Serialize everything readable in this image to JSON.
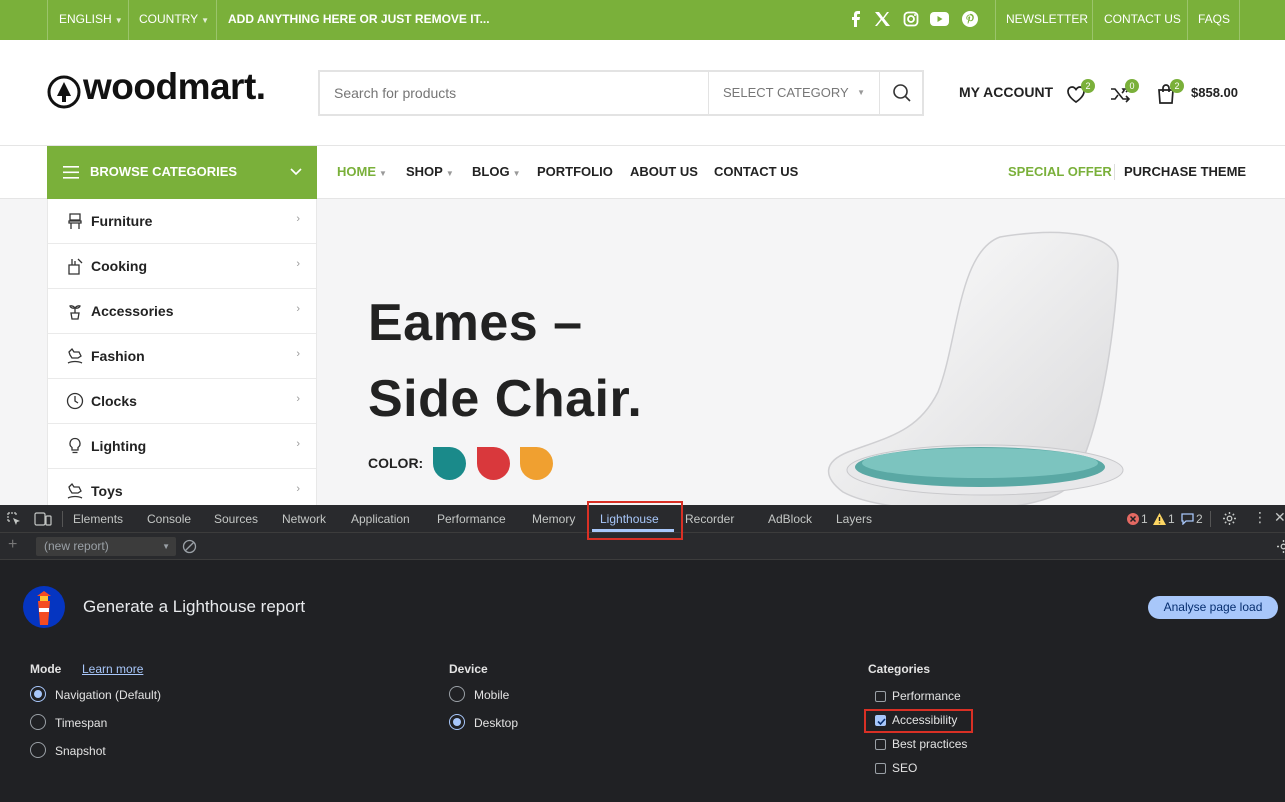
{
  "topbar": {
    "language": "ENGLISH",
    "country": "COUNTRY",
    "promo": "ADD ANYTHING HERE OR JUST REMOVE IT...",
    "social_icons": [
      "facebook-icon",
      "x-icon",
      "instagram-icon",
      "youtube-icon",
      "pinterest-icon"
    ],
    "links": [
      "NEWSLETTER",
      "CONTACT US",
      "FAQS"
    ]
  },
  "header": {
    "logo": "woodmart.",
    "search_placeholder": "Search for products",
    "select_category": "SELECT CATEGORY",
    "my_account": "MY ACCOUNT",
    "wishlist_count": "2",
    "compare_count": "0",
    "cart_count": "2",
    "cart_total": "$858.00"
  },
  "nav": {
    "browse": "BROWSE CATEGORIES",
    "items": [
      "HOME",
      "SHOP",
      "BLOG",
      "PORTFOLIO",
      "ABOUT US",
      "CONTACT US"
    ],
    "special_offer": "SPECIAL OFFER",
    "purchase_theme": "PURCHASE THEME"
  },
  "categories": [
    "Furniture",
    "Cooking",
    "Accessories",
    "Fashion",
    "Clocks",
    "Lighting",
    "Toys"
  ],
  "hero": {
    "title_line1": "Eames –",
    "title_line2": "Side Chair.",
    "color_label": "COLOR:",
    "swatches": [
      "#1a8a8a",
      "#d9383c",
      "#f0a030"
    ]
  },
  "devtools": {
    "tabs": [
      "Elements",
      "Console",
      "Sources",
      "Network",
      "Application",
      "Performance",
      "Memory",
      "Lighthouse",
      "Recorder",
      "AdBlock",
      "Layers"
    ],
    "active_tab": "Lighthouse",
    "errors": "1",
    "warnings": "1",
    "messages": "2",
    "report_select": "(new report)",
    "title": "Generate a Lighthouse report",
    "analyse_button": "Analyse page load",
    "mode": {
      "heading": "Mode",
      "learn_more": "Learn more",
      "options": [
        "Navigation (Default)",
        "Timespan",
        "Snapshot"
      ],
      "selected": "Navigation (Default)"
    },
    "device": {
      "heading": "Device",
      "options": [
        "Mobile",
        "Desktop"
      ],
      "selected": "Desktop"
    },
    "categories": {
      "heading": "Categories",
      "options": [
        "Performance",
        "Accessibility",
        "Best practices",
        "SEO"
      ],
      "checked": [
        "Accessibility"
      ]
    }
  },
  "colors": {
    "brand_green": "#7ab03a",
    "devtools_bg": "#202124",
    "accent_blue": "#a8c7fa",
    "highlight_red": "#d93025"
  }
}
